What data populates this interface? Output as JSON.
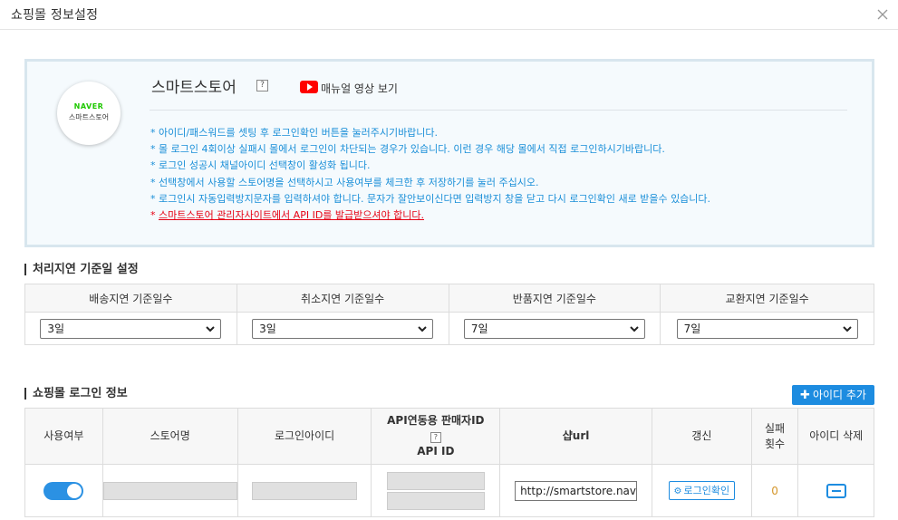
{
  "dialog": {
    "title": "쇼핑몰 정보설정",
    "close_icon": "close-icon"
  },
  "store": {
    "logo_brand": "NAVER",
    "logo_name": "스마트스토어",
    "title": "스마트스토어",
    "help": "?",
    "video_label": "매뉴얼 영상 보기",
    "notes": [
      "* 아이디/패스워드를 셋팅 후 로그인확인 버튼을 눌러주시기바랍니다.",
      "* 몰 로그인 4회이상 실패시 몰에서 로그인이 차단되는 경우가 있습니다. 이런 경우 해당 몰에서 직접 로그인하시기바랍니다.",
      "* 로그인 성공시 채널아이디 선택창이 활성화 됩니다.",
      "* 선택창에서 사용할 스토어명을 선택하시고 사용여부를 체크한 후 저장하기를 눌러 주십시오.",
      "* 로그인시 자동입력방지문자를 입력하셔야 합니다. 문자가 잘안보이신다면 입력방지 창을 닫고 다시 로그인확인 새로 받을수 있습니다."
    ],
    "warning_prefix": "* ",
    "warning_text": "스마트스토어 관리자사이트에서 API ID를 발급받으셔야 합니다."
  },
  "delay_section": {
    "title": "처리지연 기준일 설정",
    "columns": [
      "배송지연 기준일수",
      "취소지연 기준일수",
      "반품지연 기준일수",
      "교환지연 기준일수"
    ],
    "values": [
      "3일",
      "3일",
      "7일",
      "7일"
    ]
  },
  "login_section": {
    "title": "쇼핑몰 로그인 정보",
    "add_button": "아이디 추가",
    "columns": {
      "use": "사용여부",
      "store_name": "스토어명",
      "login_id": "로그인아이디",
      "api_seller_id": "API연동용 판매자ID",
      "api_help": "?",
      "api_id": "API ID",
      "shop_url": "샵url",
      "refresh": "갱신",
      "fail_count_1": "실패",
      "fail_count_2": "횟수",
      "delete": "아이디 삭제"
    },
    "row": {
      "enabled": true,
      "shop_url": "http://smartstore.naver.com",
      "login_check": "로그인확인",
      "fail_count": "0"
    }
  },
  "colors": {
    "accent": "#1d8ce0",
    "note": "#1a8fd8",
    "warning": "#e60012",
    "naver_green": "#1ec800"
  }
}
